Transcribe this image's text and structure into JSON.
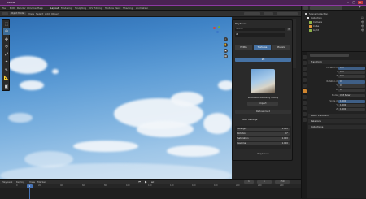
{
  "app": {
    "title": "Blender"
  },
  "menubar": {
    "items": [
      "File",
      "Edit",
      "Render",
      "Window",
      "Help",
      "Layout",
      "Modeling",
      "Sculpting",
      "UV Editing",
      "Texture Paint",
      "Shading",
      "Animation"
    ]
  },
  "viewport": {
    "mode": "Object Mode",
    "menu": [
      "View",
      "Select",
      "Add",
      "Object"
    ]
  },
  "toolbar": {
    "tools": [
      "cursor-select",
      "cursor-3d",
      "move",
      "rotate",
      "scale",
      "transform",
      "annotate",
      "measure",
      "add-cube"
    ]
  },
  "npanel": {
    "header": "Polyhaven",
    "search_placeholder": "Search",
    "tabs": [
      "HDRIs",
      "Textures",
      "Models"
    ],
    "selected_tab": "Textures",
    "category_label": "All",
    "asset_name": "Kloofendal 48d Partly Cloudy",
    "resolution": "2K",
    "import_label": "Import",
    "redownload_label": "Redownload",
    "section": "HDRI Settings",
    "fields": [
      {
        "label": "Strength",
        "value": "1.000"
      },
      {
        "label": "Rotation",
        "value": "0°"
      },
      {
        "label": "Saturation",
        "value": "1.000"
      },
      {
        "label": "Gamma",
        "value": "1.000"
      }
    ],
    "footer": "Polyhaven"
  },
  "timeline": {
    "menus": [
      "Playback",
      "Keying",
      "View",
      "Marker"
    ],
    "current_frame": "1",
    "start": "1",
    "end": "250",
    "ticks": [
      "0",
      "20",
      "40",
      "60",
      "80",
      "100",
      "120",
      "140",
      "160",
      "180",
      "200",
      "220",
      "240"
    ]
  },
  "outliner": {
    "title": "Scene Collection",
    "rows": [
      {
        "name": "Scene Collection",
        "color": "#cccccc"
      },
      {
        "name": "Collection",
        "color": "#e6e6e6"
      },
      {
        "name": "Camera",
        "color": "#8fb44a"
      },
      {
        "name": "Cube",
        "color": "#e59a3a"
      },
      {
        "name": "Light",
        "color": "#8fb44a"
      }
    ]
  },
  "properties": {
    "sections": [
      "Transform",
      "Delta Transform",
      "Relations",
      "Collections"
    ],
    "rows": [
      {
        "label": "Location X",
        "value": "0 m"
      },
      {
        "label": "Y",
        "value": "0 m"
      },
      {
        "label": "Z",
        "value": "0 m"
      },
      {
        "label": "Rotation X",
        "value": "0°"
      },
      {
        "label": "Y",
        "value": "0°"
      },
      {
        "label": "Z",
        "value": "0°"
      },
      {
        "label": "Mode",
        "value": "XYZ Euler"
      },
      {
        "label": "Scale X",
        "value": "1.000"
      },
      {
        "label": "Y",
        "value": "1.000"
      },
      {
        "label": "Z",
        "value": "1.000"
      }
    ]
  },
  "colors": {
    "accent": "#4772b3",
    "titlebar": "#4a2353",
    "sky_top": "#2f6fb3",
    "sky_bottom": "#b8d4ec"
  }
}
